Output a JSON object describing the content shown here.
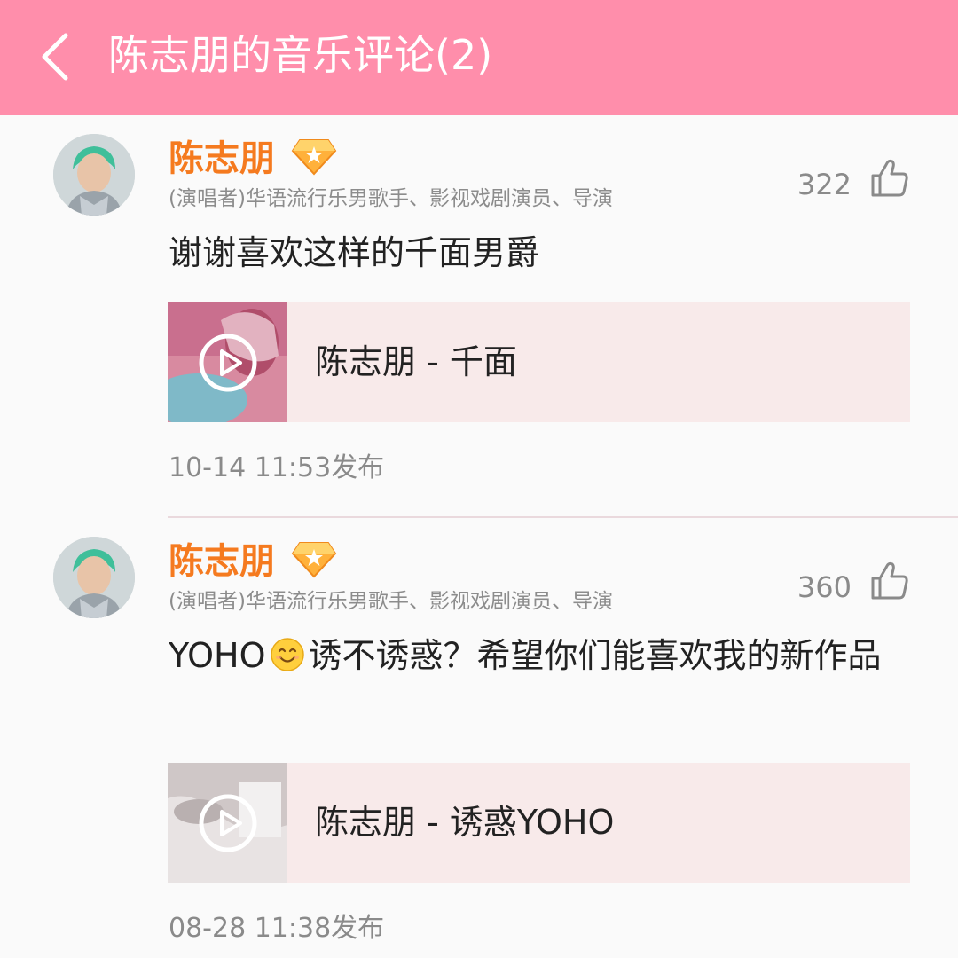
{
  "header": {
    "title": "陈志朋的音乐评论(2)"
  },
  "comments": [
    {
      "user_name": "陈志朋",
      "user_title": "(演唱者)华语流行乐男歌手、影视戏剧演员、导演",
      "likes": "322",
      "text": "谢谢喜欢这样的千面男爵",
      "song_title": "陈志朋 - 千面",
      "time": "10-14 11:53发布"
    },
    {
      "user_name": "陈志朋",
      "user_title": "(演唱者)华语流行乐男歌手、影视戏剧演员、导演",
      "likes": "360",
      "text_prefix": "YOHO",
      "text_emoji": "smile-emoji",
      "text_suffix": "诱不诱惑？希望你们能喜欢我的新作品",
      "song_title": "陈志朋 - 诱惑YOHO",
      "time": "08-28 11:38发布"
    }
  ],
  "colors": {
    "header_bg": "#ff8eab",
    "user_name": "#f57a1f",
    "card_bg": "#f8eaea"
  }
}
